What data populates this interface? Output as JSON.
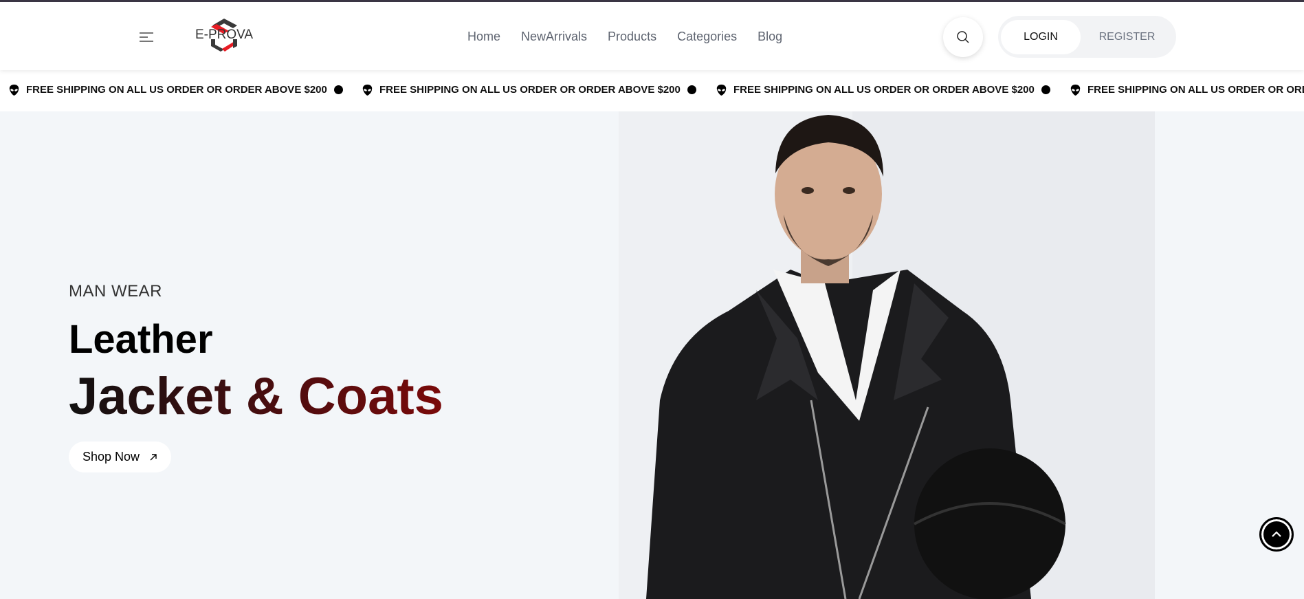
{
  "header": {
    "logo_text": "E-PROVA",
    "nav": [
      "Home",
      "NewArrivals",
      "Products",
      "Categories",
      "Blog"
    ],
    "login": "LOGIN",
    "register": "REGISTER"
  },
  "marquee": {
    "text": "FREE SHIPPING ON ALL US ORDER OR ORDER ABOVE $200"
  },
  "hero": {
    "kicker": "MAN WEAR",
    "title1": "Leather",
    "title2": "Jacket & Coats",
    "cta": "Shop Now"
  },
  "colors": {
    "accent": "#7a0a0a",
    "logo_red": "#e81c24",
    "logo_dark": "#3a3a3a"
  }
}
